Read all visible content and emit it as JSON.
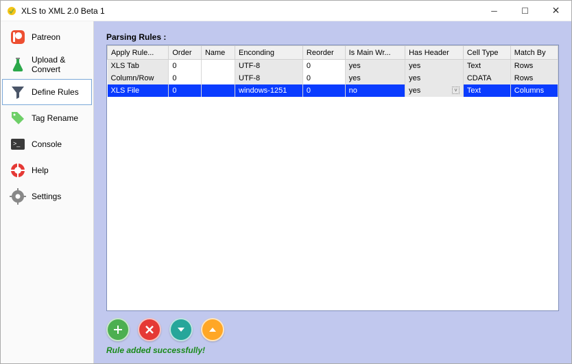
{
  "window": {
    "title": "XLS to XML 2.0 Beta 1"
  },
  "sidebar": {
    "items": [
      {
        "label": "Patreon"
      },
      {
        "label": "Upload & Convert"
      },
      {
        "label": "Define Rules"
      },
      {
        "label": "Tag Rename"
      },
      {
        "label": "Console"
      },
      {
        "label": "Help"
      },
      {
        "label": "Settings"
      }
    ]
  },
  "main": {
    "section_title": "Parsing Rules :",
    "columns": [
      "Apply Rule...",
      "Order",
      "Name",
      "Enconding",
      "Reorder",
      "Is Main Wr...",
      "Has Header",
      "Cell Type",
      "Match By"
    ],
    "rows": [
      {
        "apply": "XLS Tab",
        "order": "0",
        "name": "",
        "encoding": "UTF-8",
        "reorder": "0",
        "ismain": "yes",
        "hasheader": "yes",
        "celltype": "Text",
        "matchby": "Rows"
      },
      {
        "apply": "Column/Row",
        "order": "0",
        "name": "",
        "encoding": "UTF-8",
        "reorder": "0",
        "ismain": "yes",
        "hasheader": "yes",
        "celltype": "CDATA",
        "matchby": "Rows"
      },
      {
        "apply": "XLS File",
        "order": "0",
        "name": "",
        "encoding": "windows-1251",
        "reorder": "0",
        "ismain": "no",
        "hasheader": "yes",
        "celltype": "Text",
        "matchby": "Columns"
      }
    ],
    "status": "Rule added successfully!"
  }
}
